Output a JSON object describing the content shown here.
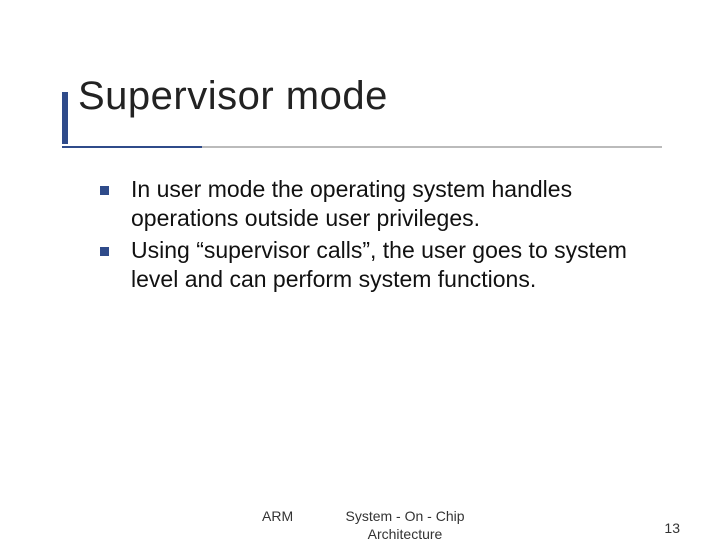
{
  "title": "Supervisor mode",
  "bullets": [
    "In user mode the operating system handles operations outside user privileges.",
    "Using “supervisor calls”, the user goes to system level and can perform system functions."
  ],
  "footer": {
    "left": "ARM",
    "center": "System - On - Chip Architecture",
    "pageNumber": "13"
  }
}
